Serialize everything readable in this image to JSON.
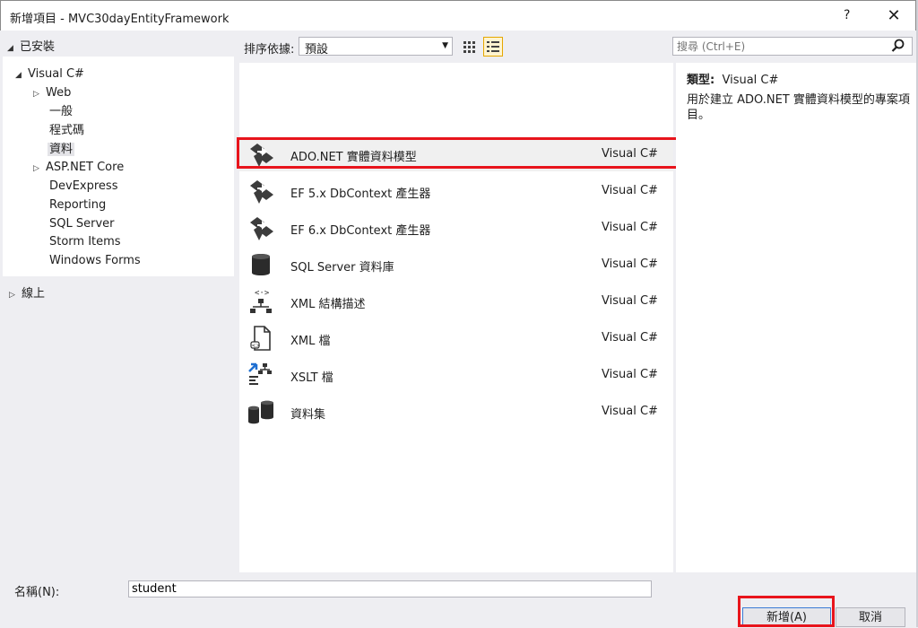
{
  "window": {
    "title": "新增項目 - MVC30dayEntityFramework",
    "help": "?",
    "close": "✕"
  },
  "tree": {
    "installed": "已安裝",
    "items": [
      {
        "label": "Visual C#"
      },
      {
        "label": "Web"
      },
      {
        "label": "一般"
      },
      {
        "label": "程式碼"
      },
      {
        "label": "資料"
      },
      {
        "label": "ASP.NET Core"
      },
      {
        "label": "DevExpress"
      },
      {
        "label": "Reporting"
      },
      {
        "label": "SQL Server"
      },
      {
        "label": "Storm Items"
      },
      {
        "label": "Windows Forms"
      }
    ],
    "online": "線上"
  },
  "toolbar": {
    "sort_label": "排序依據:",
    "sort_value": "預設",
    "search_placeholder": "搜尋 (Ctrl+E)"
  },
  "templates": [
    {
      "name": "ADO.NET 實體資料模型",
      "lang": "Visual C#",
      "icon": "entity-model-icon"
    },
    {
      "name": "EF 5.x DbContext 產生器",
      "lang": "Visual C#",
      "icon": "entity-model-icon"
    },
    {
      "name": "EF 6.x DbContext 產生器",
      "lang": "Visual C#",
      "icon": "entity-model-icon"
    },
    {
      "name": "SQL Server 資料庫",
      "lang": "Visual C#",
      "icon": "database-icon"
    },
    {
      "name": "XML 結構描述",
      "lang": "Visual C#",
      "icon": "xml-schema-icon"
    },
    {
      "name": "XML 檔",
      "lang": "Visual C#",
      "icon": "xml-file-icon"
    },
    {
      "name": "XSLT 檔",
      "lang": "Visual C#",
      "icon": "xslt-file-icon"
    },
    {
      "name": "資料集",
      "lang": "Visual C#",
      "icon": "dataset-icon"
    }
  ],
  "details": {
    "type_label": "類型:",
    "type_value": "Visual C#",
    "description": "用於建立 ADO.NET 實體資料模型的專案項目。"
  },
  "bottom": {
    "name_label": "名稱(N):",
    "name_value": "student",
    "add_button": "新增(A)",
    "cancel_button": "取消"
  },
  "colors": {
    "highlight": "#e8141c",
    "accent": "#3a7bd5"
  }
}
